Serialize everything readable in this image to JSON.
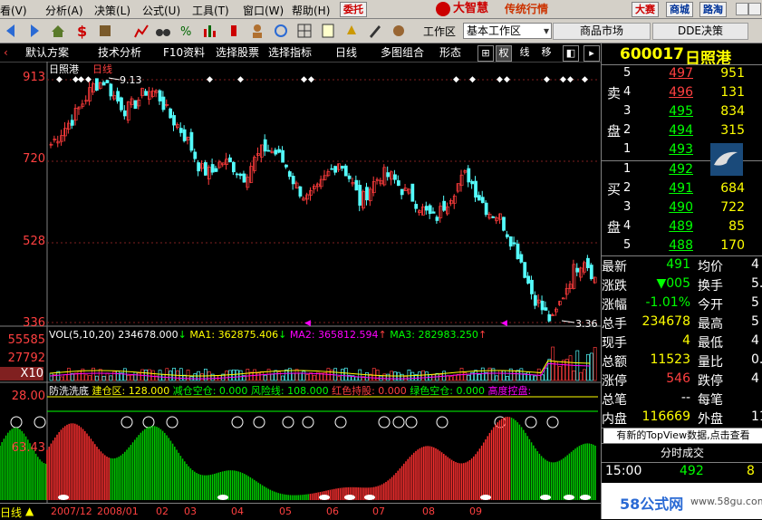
{
  "menu": {
    "items": [
      "看(V)",
      "分析(A)",
      "决策(L)",
      "公式(U)",
      "工具(T)",
      "窗口(W)",
      "帮助(H)"
    ],
    "weituo": "委托",
    "brand": "大智慧",
    "brand_sub": "传统行情",
    "dasai": "大赛",
    "shangcheng": "商城",
    "lutou": "路淘"
  },
  "toolbar1": {
    "workspace_label": "工作区",
    "workspace_value": "基本工作区",
    "tab_market": "商品市场",
    "tab_dde": "DDE决策"
  },
  "toolbar2": {
    "items": [
      "默认方案",
      "技术分析",
      "F10资料",
      "选择股票",
      "选择指标",
      "日线",
      "多图组合",
      "形态"
    ],
    "btn_quan": "权",
    "btn_xian": "线",
    "btn_yi": "移"
  },
  "chart_header": {
    "stock_name": "日照港",
    "period": "日线"
  },
  "chart_data": [
    {
      "type": "candlestick",
      "panel": "price",
      "y_ticks": [
        "913",
        "720",
        "528",
        "336"
      ],
      "annotations": [
        "9.13",
        "3.36"
      ],
      "up_color": "#ff3c3c",
      "down_color": "#54fcfc",
      "x_labels": [
        "2007/12",
        "2008/01",
        "02",
        "03",
        "04",
        "05",
        "06",
        "07",
        "08",
        "09"
      ],
      "close": [
        7.6,
        7.9,
        8.2,
        8.6,
        9.0,
        9.1,
        8.7,
        8.4,
        8.6,
        8.9,
        8.8,
        8.3,
        8.0,
        7.6,
        7.0,
        6.9,
        7.2,
        7.1,
        6.8,
        7.2,
        7.5,
        7.4,
        7.1,
        6.6,
        6.3,
        6.5,
        6.9,
        7.2,
        6.8,
        6.2,
        6.6,
        6.9,
        6.8,
        6.5,
        6.3,
        6.0,
        5.8,
        6.2,
        6.6,
        6.9,
        6.4,
        6.0,
        5.9,
        5.4,
        4.9,
        4.1,
        3.7,
        3.36,
        4.0,
        4.6,
        4.9,
        4.4
      ]
    },
    {
      "type": "bar",
      "panel": "volume",
      "title": "VOL(5,10,20)",
      "values_text": [
        {
          "label": "234678.000",
          "arrow": "↓"
        },
        {
          "label": "MA1: 362875.406",
          "arrow": "↓"
        },
        {
          "label": "MA2: 365812.594",
          "arrow": "↑"
        },
        {
          "label": "MA3: 282983.250",
          "arrow": "↑"
        }
      ],
      "y_ticks": [
        "55585",
        "27792",
        "X10"
      ]
    },
    {
      "type": "bar",
      "panel": "indicator",
      "title": "防洗洗底",
      "items": [
        {
          "label": "建仓区: 128.000",
          "color": "#ffff00"
        },
        {
          "label": "减仓空仓: 0.000",
          "color": "#00ff00"
        },
        {
          "label": "风险线: 108.000",
          "color": "#00ff00"
        },
        {
          "label": "红色持股: 0.000",
          "color": "#ff4040"
        },
        {
          "label": "绿色空仓: 0.000",
          "color": "#00ff00"
        },
        {
          "label": "高度控盘:",
          "color": "#ff00ff"
        }
      ],
      "y_ticks": [
        "28.00",
        "63.43"
      ]
    }
  ],
  "quote": {
    "code": "600017",
    "name": "日照港",
    "sell_label": [
      "卖",
      "盘"
    ],
    "buy_label": [
      "买",
      "盘"
    ],
    "sell": [
      {
        "lvl": "5",
        "price": "497",
        "vol": "951"
      },
      {
        "lvl": "4",
        "price": "496",
        "vol": "131"
      },
      {
        "lvl": "3",
        "price": "495",
        "vol": "834"
      },
      {
        "lvl": "2",
        "price": "494",
        "vol": "315"
      },
      {
        "lvl": "1",
        "price": "493",
        "vol": ""
      }
    ],
    "buy": [
      {
        "lvl": "1",
        "price": "492",
        "vol": ""
      },
      {
        "lvl": "2",
        "price": "491",
        "vol": "684"
      },
      {
        "lvl": "3",
        "price": "490",
        "vol": "722"
      },
      {
        "lvl": "4",
        "price": "489",
        "vol": "85"
      },
      {
        "lvl": "5",
        "price": "488",
        "vol": "170"
      }
    ],
    "stats": [
      {
        "l1": "最新",
        "v1": "491",
        "c1": "#00ff00",
        "l2": "均价",
        "v2": "4"
      },
      {
        "l1": "涨跌",
        "v1": "▼005",
        "c1": "#00ff00",
        "l2": "换手",
        "v2": "5.1"
      },
      {
        "l1": "涨幅",
        "v1": "-1.01%",
        "c1": "#00ff00",
        "l2": "今开",
        "v2": "5"
      },
      {
        "l1": "总手",
        "v1": "234678",
        "c1": "#ffff00",
        "l2": "最高",
        "v2": "5"
      },
      {
        "l1": "现手",
        "v1": "4",
        "c1": "#ffff00",
        "l2": "最低",
        "v2": "4"
      },
      {
        "l1": "总额",
        "v1": "11523",
        "c1": "#ffff00",
        "l2": "量比",
        "v2": "0."
      },
      {
        "l1": "涨停",
        "v1": "546",
        "c1": "#ff4040",
        "l2": "跌停",
        "v2": "4"
      },
      {
        "l1": "总笔",
        "v1": "--",
        "c1": "#ffffff",
        "l2": "每笔",
        "v2": ""
      },
      {
        "l1": "内盘",
        "v1": "116669",
        "c1": "#ffff00",
        "l2": "外盘",
        "v2": "1180"
      }
    ],
    "topview_notice": "有新的TopView数据,点击查看",
    "fenshi_title": "分时成交",
    "trade_time": "15:00",
    "trade_price": "492",
    "trade_vol": "8"
  },
  "watermark": {
    "site": "58公式网",
    "url": "www.58gu.com"
  },
  "colors": {
    "up": "#ff3c3c",
    "down": "#54fcfc",
    "quote_code": "#ffff00",
    "quote_name": "#ffff00"
  }
}
